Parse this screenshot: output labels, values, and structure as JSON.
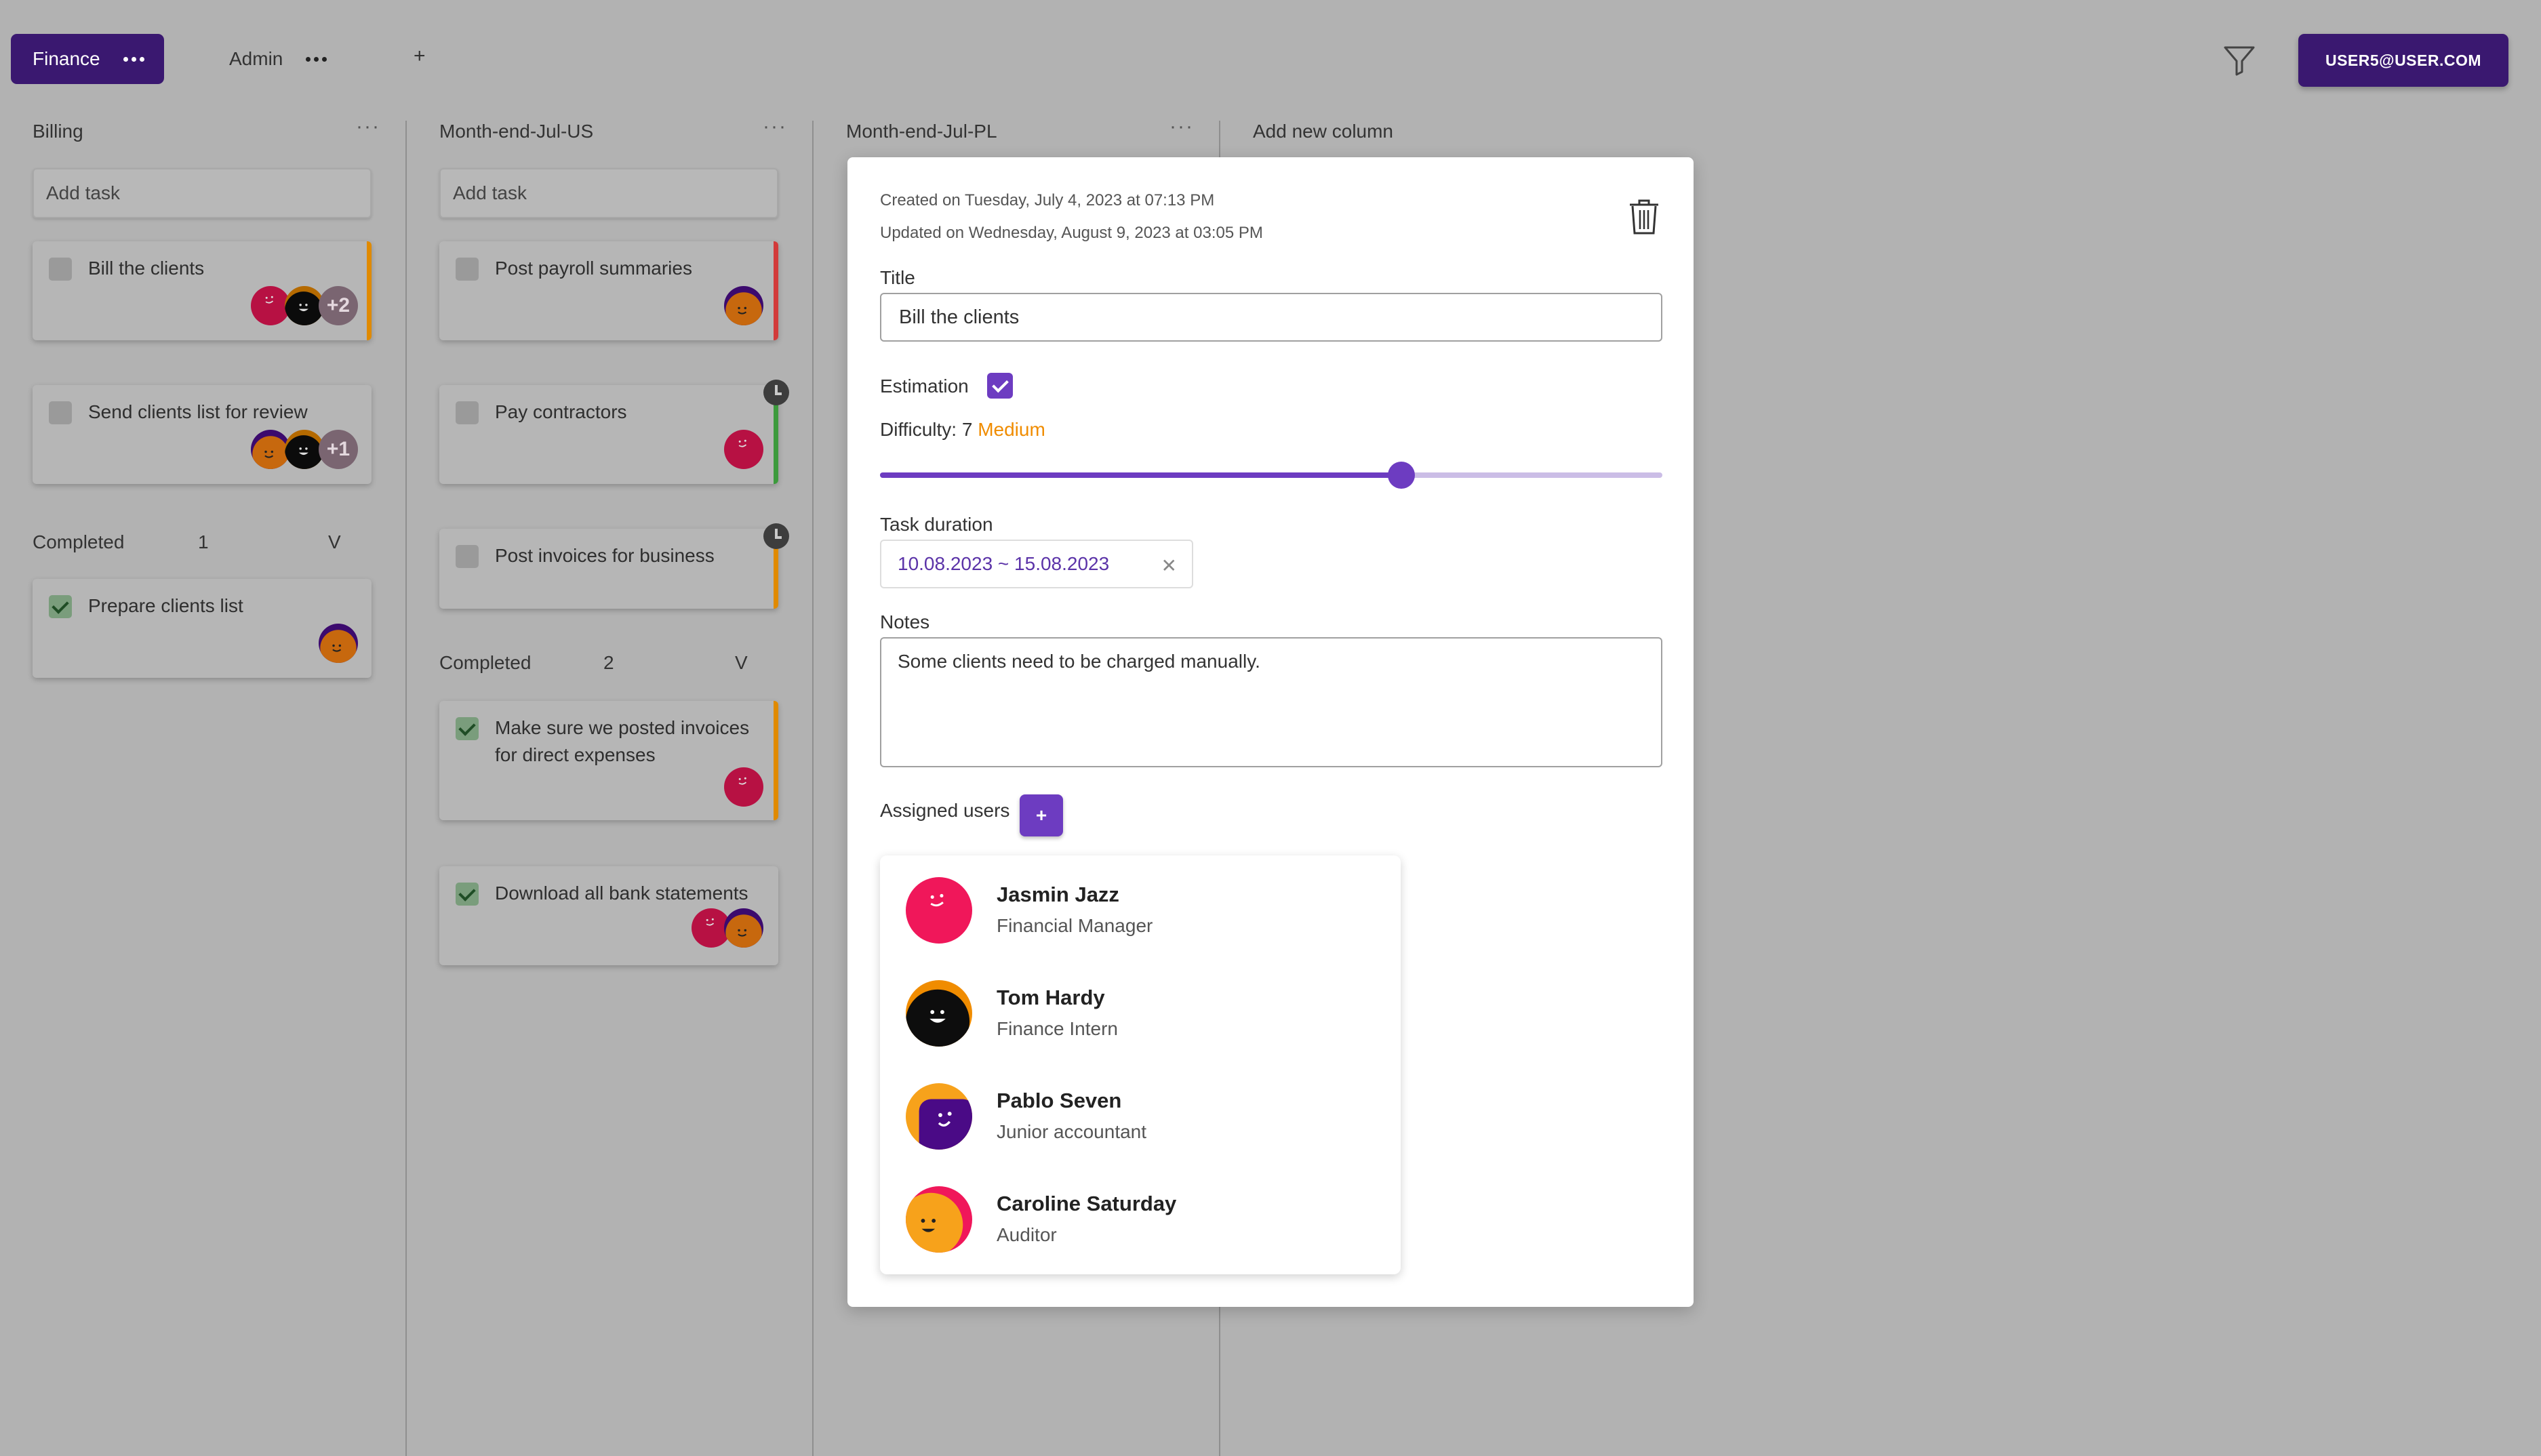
{
  "workspaces": [
    {
      "label": "Finance",
      "active": true
    },
    {
      "label": "Admin",
      "active": false
    }
  ],
  "add_workspace_label": "+",
  "user_button": "USER5@USER.COM",
  "columns": [
    {
      "title": "Billing",
      "add_task_placeholder": "Add task",
      "tasks": [
        {
          "title": "Bill the clients",
          "stripe": "#e08a00",
          "extra": "+2"
        },
        {
          "title": "Send clients list for review",
          "extra": "+1"
        }
      ],
      "completed_label": "Completed",
      "completed_count": "1",
      "completed_toggle": "V",
      "completed_tasks": [
        {
          "title": "Prepare clients list"
        }
      ]
    },
    {
      "title": "Month-end-Jul-US",
      "add_task_placeholder": "Add task",
      "tasks": [
        {
          "title": "Post payroll summaries",
          "stripe": "#d23a3a"
        },
        {
          "title": "Pay contractors",
          "stripe": "#3c9a3c"
        },
        {
          "title": "Post invoices for business",
          "stripe": "#e08a00"
        }
      ],
      "completed_label": "Completed",
      "completed_count": "2",
      "completed_toggle": "V",
      "completed_tasks": [
        {
          "title": "Make sure we posted invoices for direct expenses",
          "stripe": "#e08a00"
        },
        {
          "title": "Download all bank statements"
        }
      ]
    },
    {
      "title": "Month-end-Jul-PL"
    },
    {
      "title": "Add new column"
    }
  ],
  "modal": {
    "created": "Created on Tuesday, July 4, 2023 at 07:13 PM",
    "updated": "Updated on Wednesday, August 9, 2023 at 03:05 PM",
    "title_label": "Title",
    "title_value": "Bill the clients",
    "estimation_label": "Estimation",
    "estimation_checked": true,
    "difficulty_label": "Difficulty: 7",
    "difficulty_level": "Medium",
    "difficulty_value": 7,
    "difficulty_max": 10,
    "duration_label": "Task duration",
    "duration_value": "10.08.2023 ~ 15.08.2023",
    "notes_label": "Notes",
    "notes_value": "Some clients need to be charged manually.",
    "assigned_label": "Assigned users",
    "add_user_label": "+",
    "users": [
      {
        "name": "Jasmin Jazz",
        "role": "Financial Manager"
      },
      {
        "name": "Tom Hardy",
        "role": "Finance Intern"
      },
      {
        "name": "Pablo Seven",
        "role": "Junior accountant"
      },
      {
        "name": "Caroline Saturday",
        "role": "Auditor"
      }
    ]
  },
  "colors": {
    "primary": "#3a1870",
    "accent": "#6d3cc1",
    "medium": "#f08c00",
    "orange_stripe": "#e08a00",
    "red_stripe": "#d23a3a",
    "green_stripe": "#3c9a3c"
  }
}
